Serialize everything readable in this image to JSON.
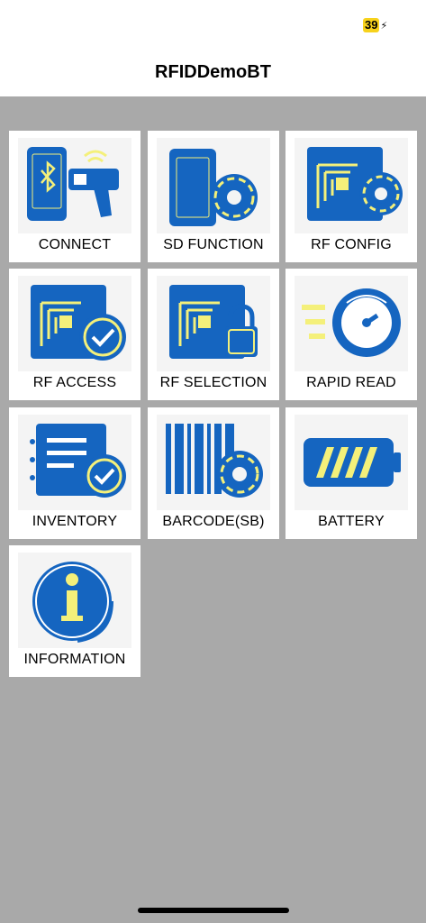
{
  "status_bar": {
    "battery_level": "39",
    "charging_icon": "charging-bolt-icon"
  },
  "header": {
    "title": "RFIDDemoBT"
  },
  "colors": {
    "icon_blue": "#1565c0",
    "icon_yellow": "#f4f07a",
    "background_gray": "#a9a9a9"
  },
  "menu": {
    "items": [
      {
        "label": "CONNECT",
        "icon": "bluetooth-scanner-icon"
      },
      {
        "label": "SD FUNCTION",
        "icon": "phone-gear-icon"
      },
      {
        "label": "RF CONFIG",
        "icon": "rfid-chip-gear-icon"
      },
      {
        "label": "RF ACCESS",
        "icon": "rfid-chip-check-icon"
      },
      {
        "label": "RF SELECTION",
        "icon": "rfid-chip-lock-icon"
      },
      {
        "label": "RAPID READ",
        "icon": "speedometer-icon"
      },
      {
        "label": "INVENTORY",
        "icon": "checklist-icon"
      },
      {
        "label": "BARCODE(SB)",
        "icon": "barcode-gear-icon"
      },
      {
        "label": "BATTERY",
        "icon": "battery-icon"
      },
      {
        "label": "INFORMATION",
        "icon": "info-icon"
      }
    ]
  }
}
